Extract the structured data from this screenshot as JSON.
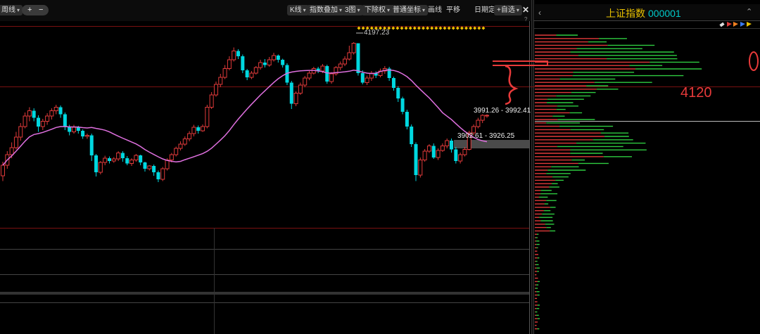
{
  "toolbar": {
    "left_label": "周线",
    "zoom_plus": "+",
    "zoom_minus": "−",
    "kline_label": "K线",
    "overlay_label": "指数叠加",
    "charts_label": "3图",
    "adjust_label": "下除权",
    "coord_label": "普通坐标",
    "draw_label": "画线",
    "pan_label": "平移",
    "date_pos_label": "日期定位",
    "watchlist_label": "+自选",
    "close_icon": "close-x-icon",
    "help": "?"
  },
  "right_panel": {
    "title": "上证指数",
    "code": "000001",
    "annotation_value": "4120",
    "header_icons": [
      "draw-pen-icon",
      "flag-red-icon",
      "flag-orange-icon",
      "flag-blue-icon",
      "flag-yellow-icon"
    ],
    "chevron_up_icon": "chevron-up-icon",
    "chevron_left_icon": "chevron-left-icon"
  },
  "colors": {
    "up": "#e03a3a",
    "down": "#00d8e0",
    "ma": "#e070e0",
    "grid": "#7a1010",
    "annot": "#e83a3a",
    "vol_red": "#e03a3a",
    "vol_green": "#2ecc40",
    "title": "#e8c000",
    "code": "#00c8c8"
  },
  "chart_data": {
    "type": "candlestick",
    "price_range": [
      3720,
      4260
    ],
    "labels": {
      "high": "4197.23",
      "range_upper": "3991.26 - 3992.41",
      "range_lower": "3902.61 - 3926.25"
    },
    "candles": [
      [
        3820,
        3850,
        3805,
        3860
      ],
      [
        3850,
        3880,
        3840,
        3890
      ],
      [
        3880,
        3900,
        3870,
        3915
      ],
      [
        3900,
        3930,
        3895,
        3945
      ],
      [
        3930,
        3960,
        3920,
        3970
      ],
      [
        3960,
        3990,
        3955,
        4000
      ],
      [
        3990,
        4005,
        3975,
        4015
      ],
      [
        4005,
        3985,
        3975,
        4012
      ],
      [
        3985,
        3960,
        3945,
        3992
      ],
      [
        3960,
        3975,
        3950,
        3982
      ],
      [
        3975,
        3990,
        3965,
        3998
      ],
      [
        3990,
        4005,
        3980,
        4012
      ],
      [
        4005,
        4015,
        3995,
        4022
      ],
      [
        4015,
        3995,
        3985,
        4020
      ],
      [
        3995,
        3960,
        3950,
        4000
      ],
      [
        3960,
        3945,
        3935,
        3965
      ],
      [
        3945,
        3958,
        3940,
        3965
      ],
      [
        3958,
        3948,
        3940,
        3962
      ],
      [
        3948,
        3932,
        3925,
        3952
      ],
      [
        3932,
        3935,
        3925,
        3940
      ],
      [
        3935,
        3878,
        3862,
        3940
      ],
      [
        3878,
        3830,
        3818,
        3882
      ],
      [
        3830,
        3858,
        3824,
        3862
      ],
      [
        3858,
        3870,
        3850,
        3877
      ],
      [
        3870,
        3862,
        3855,
        3875
      ],
      [
        3862,
        3868,
        3857,
        3873
      ],
      [
        3868,
        3885,
        3862,
        3890
      ],
      [
        3885,
        3870,
        3860,
        3890
      ],
      [
        3870,
        3855,
        3850,
        3876
      ],
      [
        3855,
        3865,
        3848,
        3870
      ],
      [
        3865,
        3878,
        3860,
        3882
      ],
      [
        3878,
        3858,
        3850,
        3880
      ],
      [
        3858,
        3840,
        3832,
        3860
      ],
      [
        3840,
        3848,
        3835,
        3850
      ],
      [
        3848,
        3830,
        3820,
        3852
      ],
      [
        3830,
        3810,
        3802,
        3835
      ],
      [
        3810,
        3840,
        3805,
        3845
      ],
      [
        3840,
        3865,
        3835,
        3870
      ],
      [
        3865,
        3880,
        3858,
        3885
      ],
      [
        3880,
        3898,
        3875,
        3903
      ],
      [
        3898,
        3910,
        3892,
        3918
      ],
      [
        3910,
        3925,
        3905,
        3932
      ],
      [
        3925,
        3940,
        3918,
        3947
      ],
      [
        3940,
        3958,
        3932,
        3965
      ],
      [
        3958,
        3948,
        3940,
        3963
      ],
      [
        3948,
        3960,
        3945,
        3966
      ],
      [
        3960,
        4015,
        3955,
        4022
      ],
      [
        4015,
        4050,
        4010,
        4058
      ],
      [
        4050,
        4080,
        4045,
        4088
      ],
      [
        4080,
        4100,
        4072,
        4110
      ],
      [
        4100,
        4125,
        4095,
        4135
      ],
      [
        4125,
        4150,
        4120,
        4160
      ],
      [
        4150,
        4175,
        4145,
        4185
      ],
      [
        4175,
        4160,
        4152,
        4180
      ],
      [
        4160,
        4120,
        4112,
        4165
      ],
      [
        4120,
        4100,
        4092,
        4124
      ],
      [
        4100,
        4112,
        4095,
        4118
      ],
      [
        4112,
        4128,
        4108,
        4132
      ],
      [
        4128,
        4142,
        4122,
        4150
      ],
      [
        4142,
        4135,
        4128,
        4152
      ],
      [
        4135,
        4150,
        4130,
        4158
      ],
      [
        4150,
        4162,
        4145,
        4170
      ],
      [
        4162,
        4150,
        4142,
        4165
      ],
      [
        4150,
        4135,
        4128,
        4153
      ],
      [
        4135,
        4085,
        4078,
        4140
      ],
      [
        4085,
        4025,
        4010,
        4090
      ],
      [
        4025,
        4055,
        4018,
        4060
      ],
      [
        4055,
        4078,
        4050,
        4085
      ],
      [
        4078,
        4098,
        4072,
        4104
      ],
      [
        4098,
        4112,
        4092,
        4118
      ],
      [
        4112,
        4125,
        4108,
        4130
      ],
      [
        4125,
        4118,
        4112,
        4130
      ],
      [
        4118,
        4132,
        4112,
        4138
      ],
      [
        4132,
        4088,
        4082,
        4136
      ],
      [
        4088,
        4110,
        4082,
        4115
      ],
      [
        4110,
        4128,
        4105,
        4132
      ],
      [
        4128,
        4138,
        4120,
        4145
      ],
      [
        4138,
        4152,
        4132,
        4160
      ],
      [
        4152,
        4170,
        4148,
        4190
      ],
      [
        4170,
        4197,
        4165,
        4200
      ],
      [
        4197,
        4112,
        4105,
        4197
      ],
      [
        4112,
        4085,
        4080,
        4120
      ],
      [
        4085,
        4098,
        4078,
        4105
      ],
      [
        4098,
        4112,
        4090,
        4118
      ],
      [
        4112,
        4105,
        4098,
        4117
      ],
      [
        4105,
        4118,
        4100,
        4125
      ],
      [
        4118,
        4125,
        4110,
        4132
      ],
      [
        4125,
        4098,
        4090,
        4130
      ],
      [
        4098,
        4070,
        4062,
        4102
      ],
      [
        4070,
        4040,
        4030,
        4075
      ],
      [
        4040,
        4002,
        3995,
        4045
      ],
      [
        4002,
        3960,
        3952,
        4008
      ],
      [
        3960,
        3910,
        3902,
        3966
      ],
      [
        3910,
        3822,
        3805,
        3915
      ],
      [
        3822,
        3865,
        3815,
        3872
      ],
      [
        3865,
        3890,
        3860,
        3896
      ],
      [
        3890,
        3905,
        3885,
        3910
      ],
      [
        3905,
        3872,
        3868,
        3912
      ],
      [
        3872,
        3892,
        3865,
        3898
      ],
      [
        3892,
        3905,
        3888,
        3912
      ],
      [
        3905,
        3920,
        3898,
        3926
      ],
      [
        3920,
        3895,
        3886,
        3926
      ],
      [
        3895,
        3862,
        3855,
        3902
      ],
      [
        3862,
        3880,
        3855,
        3886
      ],
      [
        3880,
        3895,
        3875,
        3902
      ],
      [
        3895,
        3942,
        3892,
        3948
      ],
      [
        3942,
        3960,
        3935,
        3966
      ],
      [
        3960,
        3978,
        3955,
        3985
      ],
      [
        3978,
        3992,
        3970,
        3995
      ],
      [
        3992,
        3992,
        3985,
        3995
      ]
    ]
  }
}
